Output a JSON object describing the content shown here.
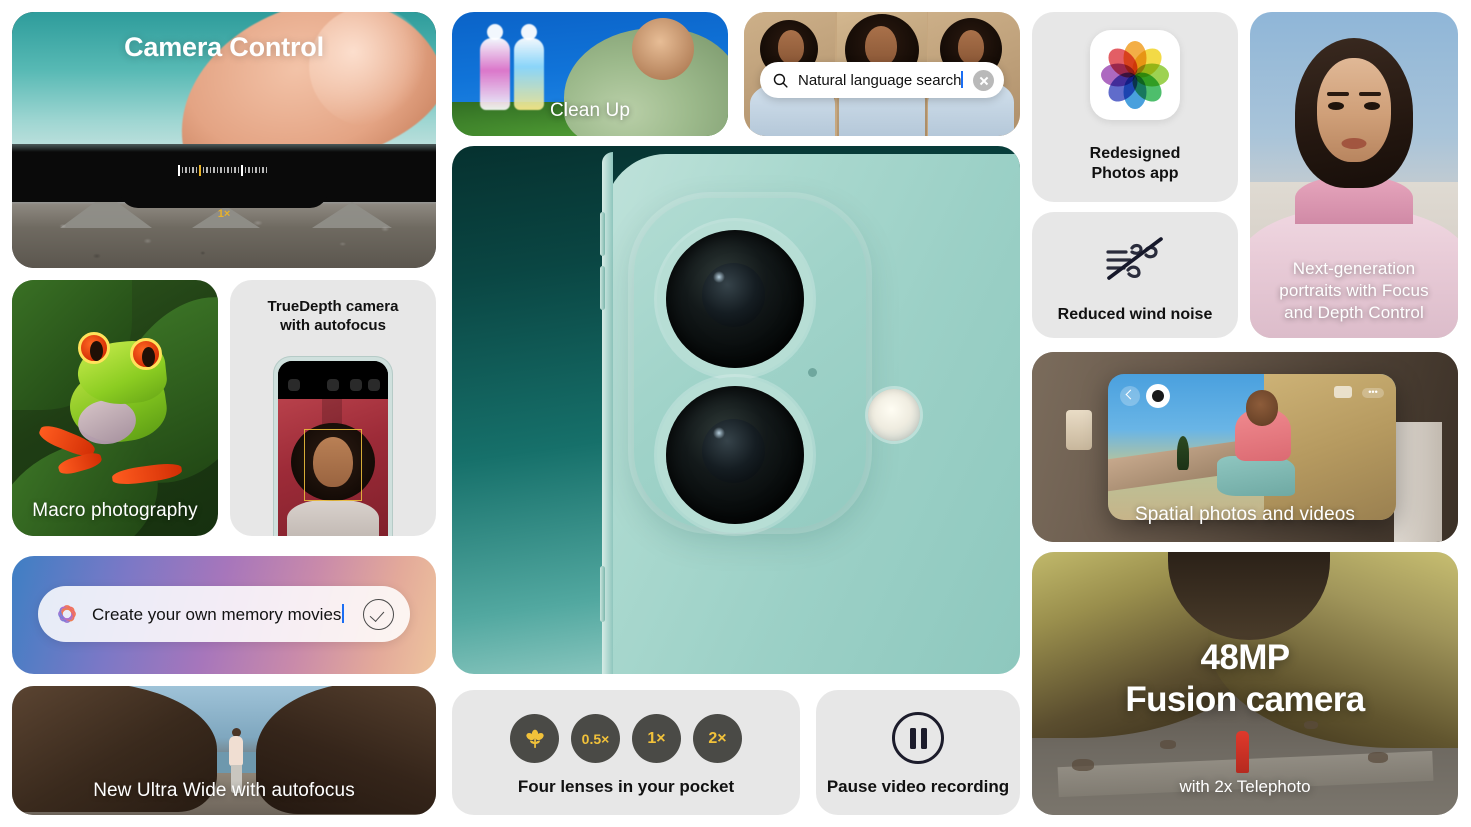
{
  "page": {
    "title": "iPhone camera features grid",
    "background_color": "#ffffff"
  },
  "cards": {
    "camera_control": {
      "title": "Camera Control",
      "zoom_label": "1×",
      "icon_finger": "finger-touch-icon",
      "icon_slider": "zoom-slider-icon"
    },
    "macro": {
      "caption": "Macro photography"
    },
    "truedepth": {
      "title_line1": "TrueDepth camera",
      "title_line2": "with autofocus"
    },
    "memory_movies": {
      "text": "Create your own memory movies",
      "icon": "apple-intelligence-icon",
      "confirm_icon": "checkmark-circle-icon"
    },
    "ultrawide": {
      "caption": "New Ultra Wide with autofocus"
    },
    "clean_up": {
      "caption": "Clean Up"
    },
    "natural_search": {
      "query": "Natural language search",
      "search_icon": "search-icon",
      "clear_icon": "clear-circle-icon"
    },
    "hero": {
      "name": "iphone-camera-module-hero"
    },
    "four_lenses": {
      "caption": "Four lenses in your pocket",
      "chips": [
        {
          "label": "",
          "icon": "macro-flower-icon"
        },
        {
          "label": "0.5×",
          "icon": ""
        },
        {
          "label": "1×",
          "icon": ""
        },
        {
          "label": "2×",
          "icon": ""
        }
      ],
      "chip_color": "#4a4a46",
      "chip_text_color": "#f2c23a"
    },
    "pause_recording": {
      "caption": "Pause video recording",
      "icon": "pause-circle-icon"
    },
    "photos_app": {
      "label_line1": "Redesigned",
      "label_line2": "Photos app",
      "icon": "photos-app-icon",
      "petal_colors": [
        "#f2a32c",
        "#f2d52c",
        "#8fcc3a",
        "#35b558",
        "#2f93d9",
        "#4a57c4",
        "#a254b8",
        "#e0484f"
      ]
    },
    "wind_noise": {
      "caption": "Reduced wind noise",
      "icon": "wind-slash-icon"
    },
    "portraits": {
      "caption_line1": "Next-generation",
      "caption_line2": "portraits with Focus",
      "caption_line3": "and Depth Control"
    },
    "spatial": {
      "caption": "Spatial photos and videos",
      "back_icon": "chevron-left-icon",
      "immersive_icon": "immersive-badge-icon",
      "video_icon": "video-icon",
      "more_icon": "more-dots-icon",
      "more_label": "•••"
    },
    "fusion": {
      "headline_line1": "48MP",
      "headline_line2": "Fusion camera",
      "subtext": "with 2x Telephoto"
    }
  }
}
